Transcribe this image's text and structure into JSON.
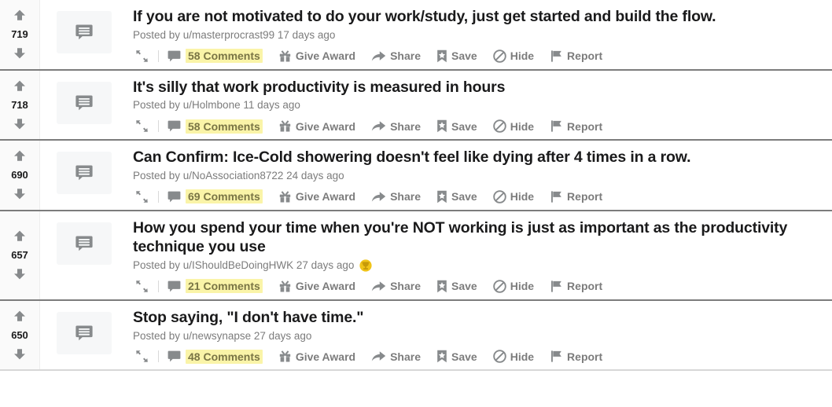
{
  "page": {
    "title": "Reddit post listing",
    "accent_highlight_color": "#faf4a8",
    "comment_text_color": "#7a7545",
    "muted_color": "#7c7c7c",
    "text_color": "#1a1a1b"
  },
  "icons": {
    "upvote": "upvote-arrow-icon",
    "downvote": "downvote-arrow-icon",
    "thumbnail": "text-post-bubble-icon",
    "expand": "expand-arrows-icon",
    "comments": "comment-bubble-icon",
    "award": "gift-icon",
    "share": "share-arrow-icon",
    "save": "bookmark-star-icon",
    "hide": "block-circle-icon",
    "report": "flag-icon",
    "post_award": "gold-award-icon"
  },
  "actions": {
    "give_award": "Give Award",
    "share": "Share",
    "save": "Save",
    "hide": "Hide",
    "report": "Report"
  },
  "posts": [
    {
      "score": "719",
      "title": "If you are not motivated to do your work/study, just get started and build the flow.",
      "meta": "Posted by u/masterprocrast99 17 days ago",
      "comments": "58 Comments",
      "has_award": false
    },
    {
      "score": "718",
      "title": "It's silly that work productivity is measured in hours",
      "meta": "Posted by u/Holmbone 11 days ago",
      "comments": "58 Comments",
      "has_award": false
    },
    {
      "score": "690",
      "title": "Can Confirm: Ice-Cold showering doesn't feel like dying after 4 times in a row.",
      "meta": "Posted by u/NoAssociation8722 24 days ago",
      "comments": "69 Comments",
      "has_award": false
    },
    {
      "score": "657",
      "title": "How you spend your time when you're NOT working is just as important as the productivity technique you use",
      "meta": "Posted by u/IShouldBeDoingHWK 27 days ago",
      "comments": "21 Comments",
      "has_award": true
    },
    {
      "score": "650",
      "title": "Stop saying, \"I don't have time.\"",
      "meta": "Posted by u/newsynapse 27 days ago",
      "comments": "48 Comments",
      "has_award": false
    }
  ]
}
